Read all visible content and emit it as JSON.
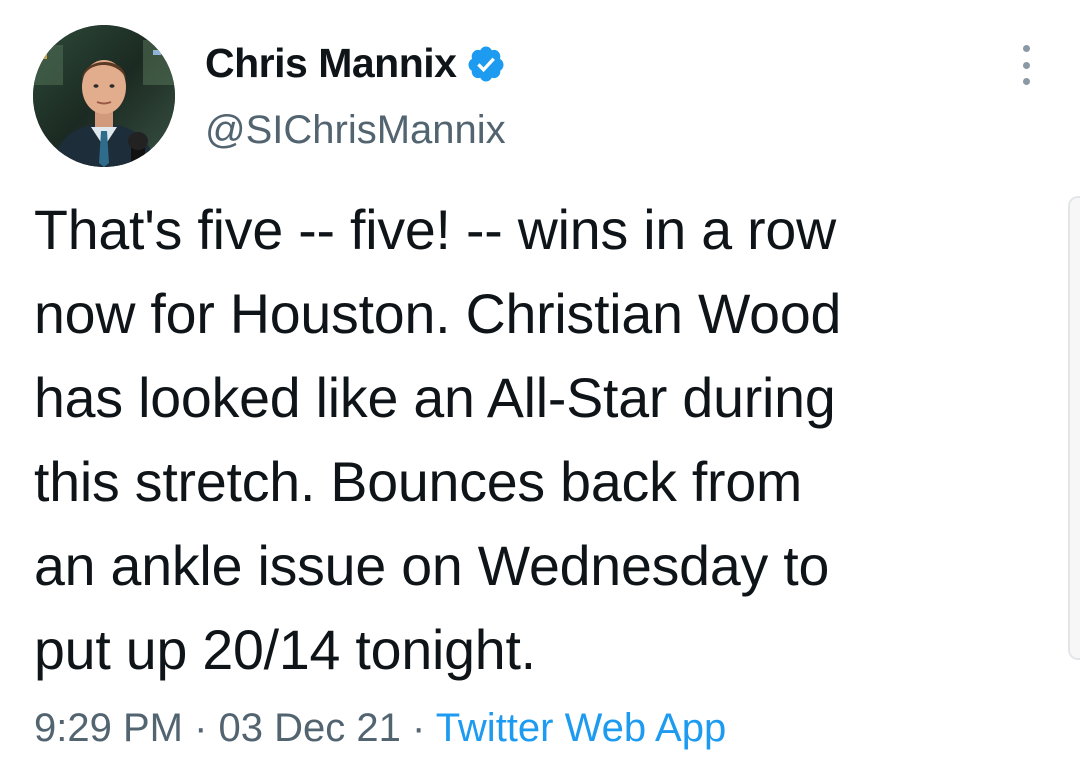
{
  "tweet": {
    "author": {
      "display_name": "Chris Mannix",
      "handle": "@SIChrisMannix",
      "verified": true,
      "verified_icon": "verified-badge-icon"
    },
    "text": "That's five -- five! -- wins in a row\nnow for Houston. Christian Wood\nhas looked like an All-Star during\nthis stretch. Bounces back from\nan ankle issue on Wednesday to\nput up 20/14 tonight.",
    "time": "9:29 PM",
    "separator": " · ",
    "date": "03 Dec 21",
    "source": "Twitter Web App"
  },
  "icons": {
    "more": "more-vertical-icon"
  },
  "colors": {
    "text": "#0f1419",
    "secondary": "#536471",
    "link": "#1d9bf0",
    "verified": "#1d9bf0"
  }
}
